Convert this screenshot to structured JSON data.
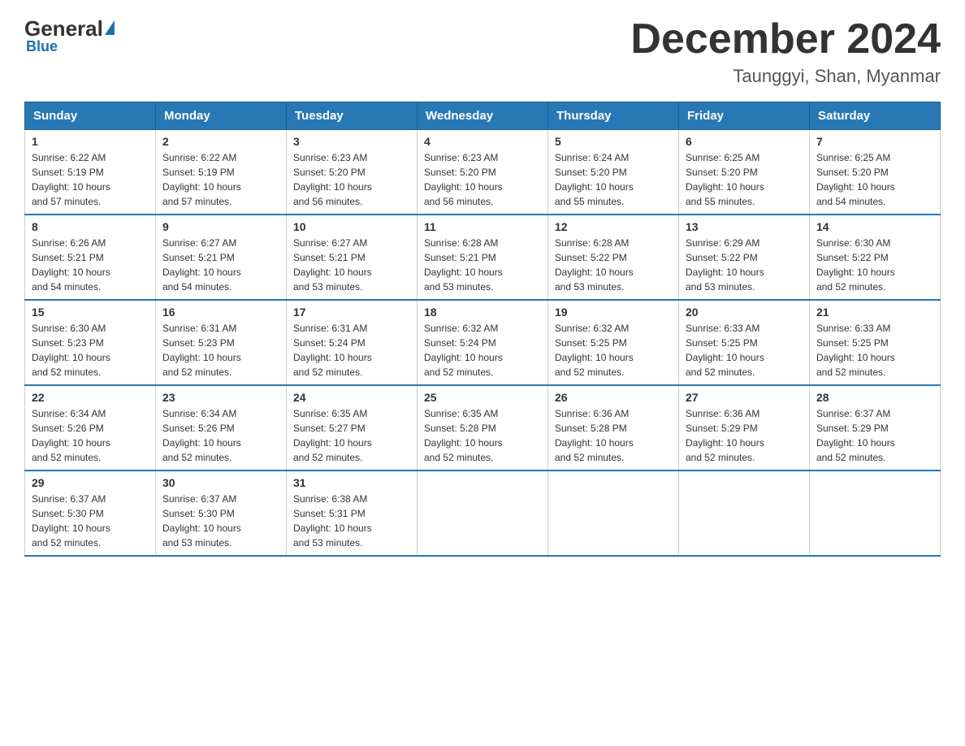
{
  "logo": {
    "general": "General",
    "blue_suffix": "Blue",
    "underline": "Blue"
  },
  "header": {
    "title": "December 2024",
    "subtitle": "Taunggyi, Shan, Myanmar"
  },
  "weekdays": [
    "Sunday",
    "Monday",
    "Tuesday",
    "Wednesday",
    "Thursday",
    "Friday",
    "Saturday"
  ],
  "weeks": [
    [
      {
        "day": "1",
        "sunrise": "6:22 AM",
        "sunset": "5:19 PM",
        "daylight": "10 hours and 57 minutes."
      },
      {
        "day": "2",
        "sunrise": "6:22 AM",
        "sunset": "5:19 PM",
        "daylight": "10 hours and 57 minutes."
      },
      {
        "day": "3",
        "sunrise": "6:23 AM",
        "sunset": "5:20 PM",
        "daylight": "10 hours and 56 minutes."
      },
      {
        "day": "4",
        "sunrise": "6:23 AM",
        "sunset": "5:20 PM",
        "daylight": "10 hours and 56 minutes."
      },
      {
        "day": "5",
        "sunrise": "6:24 AM",
        "sunset": "5:20 PM",
        "daylight": "10 hours and 55 minutes."
      },
      {
        "day": "6",
        "sunrise": "6:25 AM",
        "sunset": "5:20 PM",
        "daylight": "10 hours and 55 minutes."
      },
      {
        "day": "7",
        "sunrise": "6:25 AM",
        "sunset": "5:20 PM",
        "daylight": "10 hours and 54 minutes."
      }
    ],
    [
      {
        "day": "8",
        "sunrise": "6:26 AM",
        "sunset": "5:21 PM",
        "daylight": "10 hours and 54 minutes."
      },
      {
        "day": "9",
        "sunrise": "6:27 AM",
        "sunset": "5:21 PM",
        "daylight": "10 hours and 54 minutes."
      },
      {
        "day": "10",
        "sunrise": "6:27 AM",
        "sunset": "5:21 PM",
        "daylight": "10 hours and 53 minutes."
      },
      {
        "day": "11",
        "sunrise": "6:28 AM",
        "sunset": "5:21 PM",
        "daylight": "10 hours and 53 minutes."
      },
      {
        "day": "12",
        "sunrise": "6:28 AM",
        "sunset": "5:22 PM",
        "daylight": "10 hours and 53 minutes."
      },
      {
        "day": "13",
        "sunrise": "6:29 AM",
        "sunset": "5:22 PM",
        "daylight": "10 hours and 53 minutes."
      },
      {
        "day": "14",
        "sunrise": "6:30 AM",
        "sunset": "5:22 PM",
        "daylight": "10 hours and 52 minutes."
      }
    ],
    [
      {
        "day": "15",
        "sunrise": "6:30 AM",
        "sunset": "5:23 PM",
        "daylight": "10 hours and 52 minutes."
      },
      {
        "day": "16",
        "sunrise": "6:31 AM",
        "sunset": "5:23 PM",
        "daylight": "10 hours and 52 minutes."
      },
      {
        "day": "17",
        "sunrise": "6:31 AM",
        "sunset": "5:24 PM",
        "daylight": "10 hours and 52 minutes."
      },
      {
        "day": "18",
        "sunrise": "6:32 AM",
        "sunset": "5:24 PM",
        "daylight": "10 hours and 52 minutes."
      },
      {
        "day": "19",
        "sunrise": "6:32 AM",
        "sunset": "5:25 PM",
        "daylight": "10 hours and 52 minutes."
      },
      {
        "day": "20",
        "sunrise": "6:33 AM",
        "sunset": "5:25 PM",
        "daylight": "10 hours and 52 minutes."
      },
      {
        "day": "21",
        "sunrise": "6:33 AM",
        "sunset": "5:25 PM",
        "daylight": "10 hours and 52 minutes."
      }
    ],
    [
      {
        "day": "22",
        "sunrise": "6:34 AM",
        "sunset": "5:26 PM",
        "daylight": "10 hours and 52 minutes."
      },
      {
        "day": "23",
        "sunrise": "6:34 AM",
        "sunset": "5:26 PM",
        "daylight": "10 hours and 52 minutes."
      },
      {
        "day": "24",
        "sunrise": "6:35 AM",
        "sunset": "5:27 PM",
        "daylight": "10 hours and 52 minutes."
      },
      {
        "day": "25",
        "sunrise": "6:35 AM",
        "sunset": "5:28 PM",
        "daylight": "10 hours and 52 minutes."
      },
      {
        "day": "26",
        "sunrise": "6:36 AM",
        "sunset": "5:28 PM",
        "daylight": "10 hours and 52 minutes."
      },
      {
        "day": "27",
        "sunrise": "6:36 AM",
        "sunset": "5:29 PM",
        "daylight": "10 hours and 52 minutes."
      },
      {
        "day": "28",
        "sunrise": "6:37 AM",
        "sunset": "5:29 PM",
        "daylight": "10 hours and 52 minutes."
      }
    ],
    [
      {
        "day": "29",
        "sunrise": "6:37 AM",
        "sunset": "5:30 PM",
        "daylight": "10 hours and 52 minutes."
      },
      {
        "day": "30",
        "sunrise": "6:37 AM",
        "sunset": "5:30 PM",
        "daylight": "10 hours and 53 minutes."
      },
      {
        "day": "31",
        "sunrise": "6:38 AM",
        "sunset": "5:31 PM",
        "daylight": "10 hours and 53 minutes."
      },
      null,
      null,
      null,
      null
    ]
  ],
  "labels": {
    "sunrise": "Sunrise:",
    "sunset": "Sunset:",
    "daylight": "Daylight:"
  }
}
